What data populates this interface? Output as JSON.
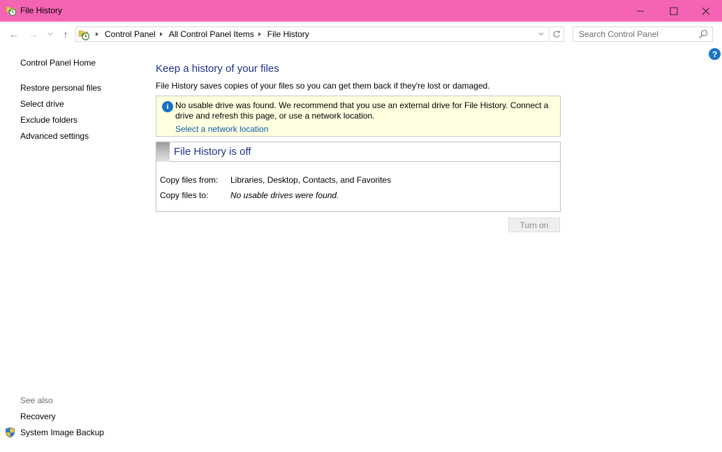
{
  "window": {
    "title": "File History",
    "app_icon": "file-history-icon",
    "controls": {
      "minimize": "minimize-icon",
      "maximize": "maximize-icon",
      "close": "close-icon"
    },
    "titlebar_color": "#f564b3"
  },
  "navbar": {
    "back": "←",
    "forward": "→",
    "recent": "⌄",
    "up": "↑",
    "breadcrumb": [
      "Control Panel",
      "All Control Panel Items",
      "File History"
    ],
    "search_placeholder": "Search Control Panel"
  },
  "help": {
    "label": "?"
  },
  "sidebar": {
    "home": "Control Panel Home",
    "items": [
      {
        "label": "Restore personal files"
      },
      {
        "label": "Select drive"
      },
      {
        "label": "Exclude folders"
      },
      {
        "label": "Advanced settings"
      }
    ],
    "see_also": {
      "heading": "See also",
      "items": [
        {
          "label": "Recovery"
        },
        {
          "label": "System Image Backup",
          "icon": "uac-shield-icon"
        }
      ]
    }
  },
  "main": {
    "title": "Keep a history of your files",
    "description": "File History saves copies of your files so you can get them back if they're lost or damaged.",
    "info": {
      "icon": "i",
      "message": "No usable drive was found. We recommend that you use an external drive for File History. Connect a drive and refresh this page, or use a network location.",
      "link": "Select a network location"
    },
    "status": {
      "title": "File History is off",
      "rows": [
        {
          "label": "Copy files from:",
          "value": "Libraries, Desktop, Contacts, and Favorites"
        },
        {
          "label": "Copy files to:",
          "value": "No usable drives were found."
        }
      ]
    },
    "turn_on_label": "Turn on"
  }
}
